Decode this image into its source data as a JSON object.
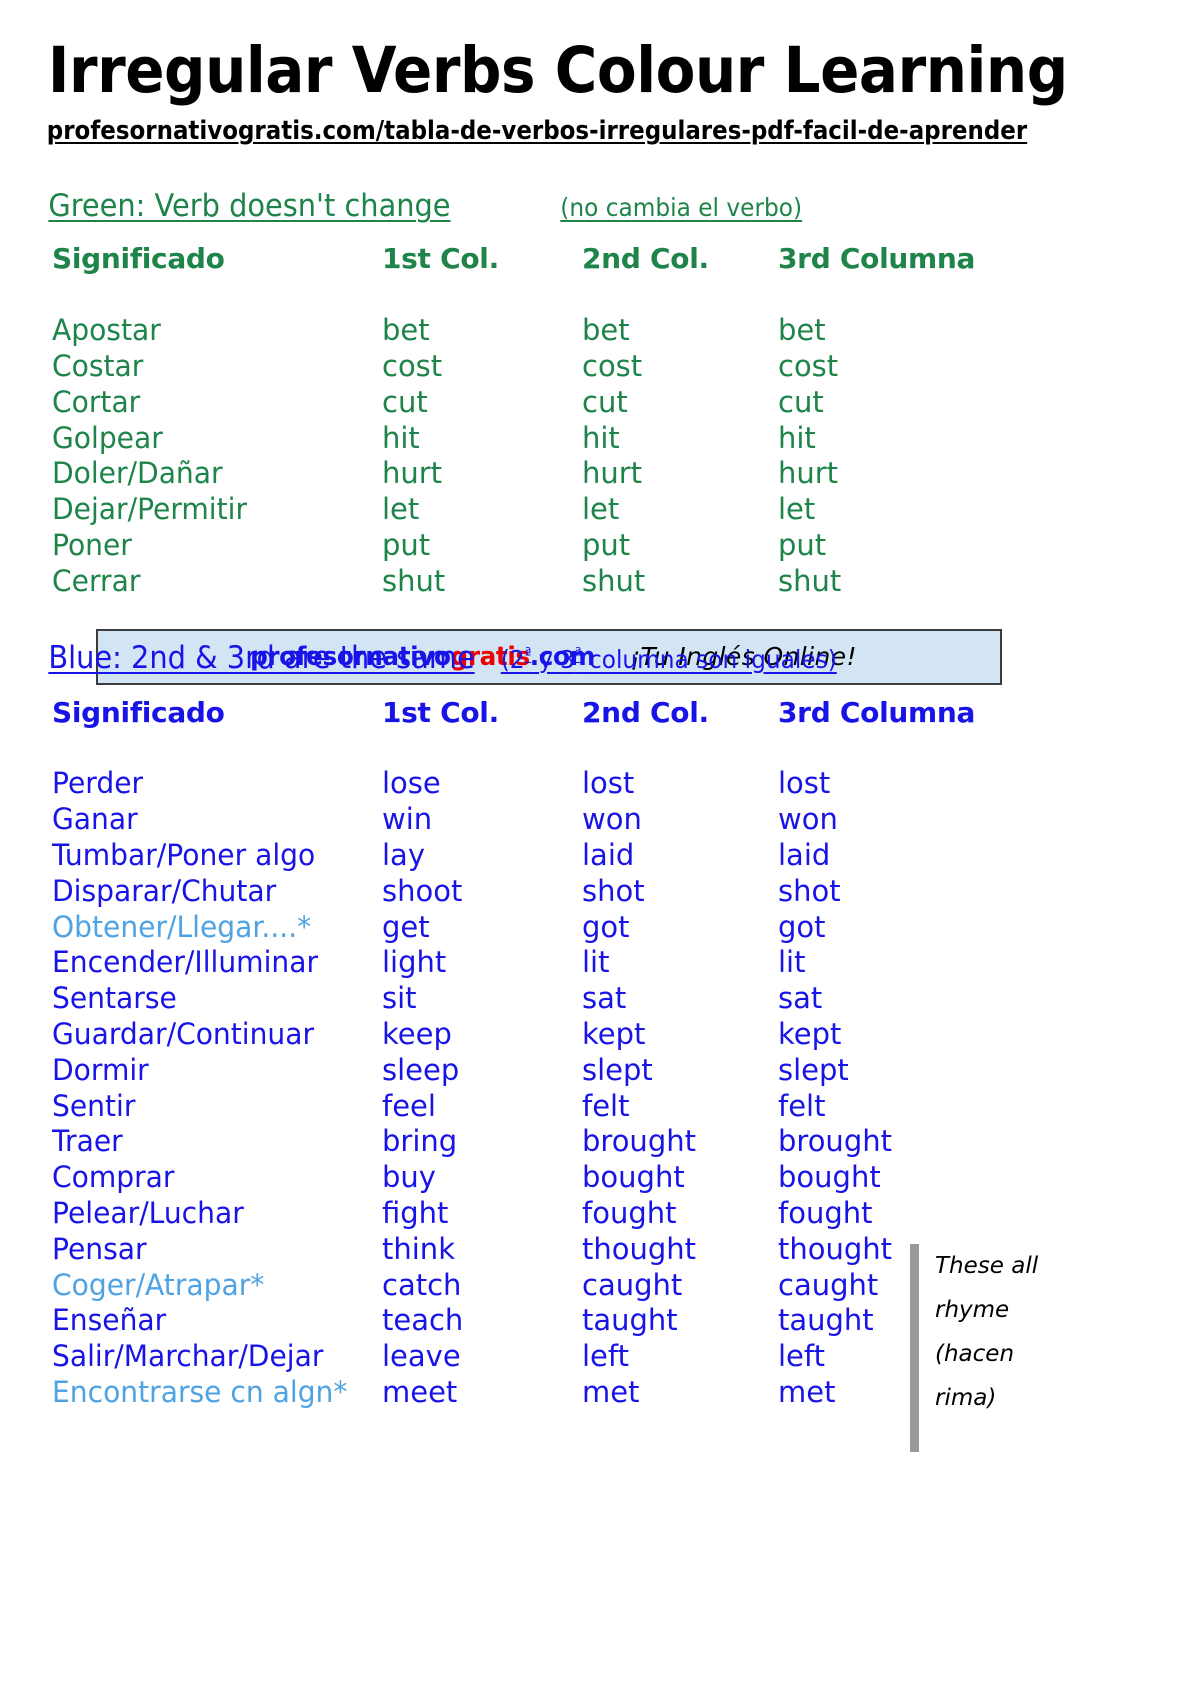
{
  "document": {
    "title": "Irregular Verbs Colour Learning",
    "subtitle_url": "profesornativogratis.com/tabla-de-verbos-irregulares-pdf-facil-de-aprender"
  },
  "colors": {
    "green": "#1E8449",
    "blue": "#1814E8",
    "light_blue": "#4FA3E3",
    "red": "#EE0000",
    "banner_bg": "#D3E5F5",
    "banner_border": "#3C3C3C",
    "rhyme_bar": "#9A9A9A",
    "black": "#000000"
  },
  "green_section": {
    "heading_main": "Green: Verb doesn't change",
    "heading_sub": "(no cambia el verbo)",
    "columns": [
      "Significado",
      "1st Col.",
      "2nd Col.",
      "3rd Columna"
    ],
    "rows": [
      {
        "meaning": "Apostar",
        "col1": "bet",
        "col2": "bet",
        "col3": "bet",
        "highlight": false
      },
      {
        "meaning": "Costar",
        "col1": "cost",
        "col2": "cost",
        "col3": "cost",
        "highlight": false
      },
      {
        "meaning": "Cortar",
        "col1": "cut",
        "col2": "cut",
        "col3": "cut",
        "highlight": false
      },
      {
        "meaning": "Golpear",
        "col1": "hit",
        "col2": "hit",
        "col3": "hit",
        "highlight": false
      },
      {
        "meaning": "Doler/Dañar",
        "col1": "hurt",
        "col2": "hurt",
        "col3": "hurt",
        "highlight": false
      },
      {
        "meaning": "Dejar/Permitir",
        "col1": "let",
        "col2": "let",
        "col3": "let",
        "highlight": false
      },
      {
        "meaning": "Poner",
        "col1": "put",
        "col2": "put",
        "col3": "put",
        "highlight": false
      },
      {
        "meaning": "Cerrar",
        "col1": "shut",
        "col2": "shut",
        "col3": "shut",
        "highlight": false
      }
    ]
  },
  "banner": {
    "brand_part1": "profesornativo",
    "brand_part2": "gratis",
    "brand_part3": ".com",
    "tagline": "¡Tu Inglés Online!"
  },
  "blue_section": {
    "heading_main": "Blue: 2nd & 3rd are the same",
    "heading_sub_prefix": "(2",
    "heading_sub_ord1": "ª",
    "heading_sub_mid": " y 3",
    "heading_sub_ord2": "ª",
    "heading_sub_suffix": " columna son iguales)",
    "columns": [
      "Significado",
      "1st Col.",
      "2nd Col.",
      "3rd Columna"
    ],
    "rows": [
      {
        "meaning": "Perder",
        "col1": "lose",
        "col2": "lost",
        "col3": "lost",
        "highlight": false
      },
      {
        "meaning": "Ganar",
        "col1": "win",
        "col2": "won",
        "col3": "won",
        "highlight": false
      },
      {
        "meaning": "Tumbar/Poner algo",
        "col1": "lay",
        "col2": "laid",
        "col3": "laid",
        "highlight": false
      },
      {
        "meaning": "Disparar/Chutar",
        "col1": "shoot",
        "col2": "shot",
        "col3": "shot",
        "highlight": false
      },
      {
        "meaning": "Obtener/Llegar....*",
        "col1": "get",
        "col2": "got",
        "col3": "got",
        "highlight": true
      },
      {
        "meaning": "Encender/Illuminar",
        "col1": "light",
        "col2": "lit",
        "col3": "lit",
        "highlight": false
      },
      {
        "meaning": "Sentarse",
        "col1": "sit",
        "col2": "sat",
        "col3": "sat",
        "highlight": false
      },
      {
        "meaning": "Guardar/Continuar",
        "col1": "keep",
        "col2": "kept",
        "col3": "kept",
        "highlight": false
      },
      {
        "meaning": "Dormir",
        "col1": "sleep",
        "col2": "slept",
        "col3": "slept",
        "highlight": false
      },
      {
        "meaning": "Sentir",
        "col1": "feel",
        "col2": "felt",
        "col3": "felt",
        "highlight": false
      },
      {
        "meaning": "Traer",
        "col1": "bring",
        "col2": "brought",
        "col3": "brought",
        "highlight": false
      },
      {
        "meaning": "Comprar",
        "col1": "buy",
        "col2": "bought",
        "col3": "bought",
        "highlight": false
      },
      {
        "meaning": "Pelear/Luchar",
        "col1": "fight",
        "col2": "fought",
        "col3": "fought",
        "highlight": false
      },
      {
        "meaning": "Pensar",
        "col1": "think",
        "col2": "thought",
        "col3": "thought",
        "highlight": false
      },
      {
        "meaning": "Coger/Atrapar*",
        "col1": "catch",
        "col2": "caught",
        "col3": "caught",
        "highlight": true
      },
      {
        "meaning": "Enseñar",
        "col1": "teach",
        "col2": "taught",
        "col3": "taught",
        "highlight": false
      },
      {
        "meaning": "Salir/Marchar/Dejar",
        "col1": "leave",
        "col2": "left",
        "col3": "left",
        "highlight": false
      },
      {
        "meaning": "Encontrarse cn algn*",
        "col1": "meet",
        "col2": "met",
        "col3": "met",
        "highlight": true
      }
    ]
  },
  "rhyme_note": {
    "line1": "These all",
    "line2": "rhyme",
    "line3": "(hacen",
    "line4": "rima)"
  }
}
